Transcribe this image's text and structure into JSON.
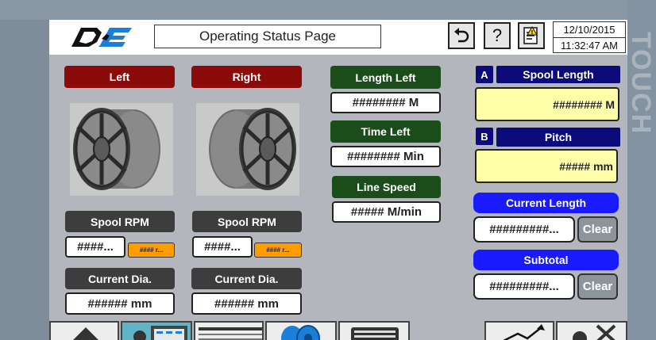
{
  "header": {
    "title": "Operating Status Page",
    "date": "12/10/2015",
    "time": "11:32:47 AM",
    "icons": [
      "undo-icon",
      "help-icon",
      "alarm-notes-icon"
    ],
    "logo": "D&E"
  },
  "bezel_text": "TOUCH",
  "left": {
    "label": "Left",
    "spool_rpm_label": "Spool RPM",
    "spool_rpm_value": "####...",
    "spool_rpm_unit_badge": "#### r...",
    "current_dia_label": "Current Dia.",
    "current_dia_value": "###### mm"
  },
  "right": {
    "label": "Right",
    "spool_rpm_label": "Spool RPM",
    "spool_rpm_value": "####...",
    "spool_rpm_unit_badge": "#### r...",
    "current_dia_label": "Current Dia.",
    "current_dia_value": "###### mm"
  },
  "center": {
    "length_left_label": "Length Left",
    "length_left_value": "######## M",
    "time_left_label": "Time Left",
    "time_left_value": "######## Min",
    "line_speed_label": "Line Speed",
    "line_speed_value": "##### M/min"
  },
  "settings": {
    "spool_length_letter": "A",
    "spool_length_label": "Spool Length",
    "spool_length_value": "######## M",
    "pitch_letter": "B",
    "pitch_label": "Pitch",
    "pitch_value": "##### mm",
    "current_length_label": "Current Length",
    "current_length_value": "#########...",
    "subtotal_label": "Subtotal",
    "subtotal_value": "#########...",
    "clear_label": "Clear"
  },
  "colors": {
    "red_label": "#8b0a0a",
    "green_label": "#1a4d1a",
    "navy_label": "#0b0b7a",
    "blue_label": "#1a1aff",
    "yellow_field": "#ffffaa",
    "orange_badge": "#ff9c00"
  },
  "bottom_tabs": [
    "home-tab",
    "status-tab",
    "process-tab",
    "spools-tab",
    "machine-tab",
    "trend-tab",
    "maintenance-tab"
  ]
}
